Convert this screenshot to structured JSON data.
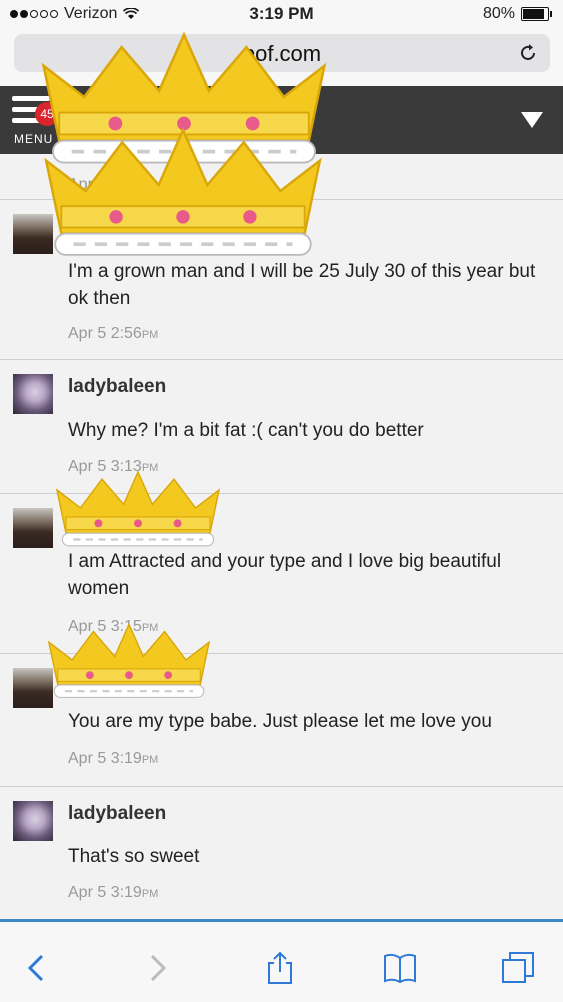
{
  "status": {
    "carrier": "Verizon",
    "time": "3:19 PM",
    "battery": "80%",
    "signal_bars_filled": 2,
    "battery_level": 0.8
  },
  "browser": {
    "url": "pof.com"
  },
  "header": {
    "menu_label": "MENU",
    "notification_count": "45"
  },
  "messages": [
    {
      "sender_type": "man",
      "sender": "",
      "text": "",
      "time": "Apr 5 2:54",
      "ampm": "PM"
    },
    {
      "sender_type": "man",
      "sender": "",
      "text": "I'm a grown man and I will be 25 July 30 of this year but ok then",
      "time": "Apr 5 2:56",
      "ampm": "PM"
    },
    {
      "sender_type": "lady",
      "sender": "ladybaleen",
      "text": "Why me? I'm a bit fat :( can't you do better",
      "time": "Apr 5 3:13",
      "ampm": "PM"
    },
    {
      "sender_type": "man",
      "sender": "",
      "text": "I am Attracted and your type and I love big beautiful women",
      "time": "Apr 5 3:15",
      "ampm": "PM"
    },
    {
      "sender_type": "man",
      "sender": "",
      "text": "You are my type babe. Just please let me love you",
      "time": "Apr 5 3:19",
      "ampm": "PM"
    },
    {
      "sender_type": "lady",
      "sender": "ladybaleen",
      "text": "That's so sweet",
      "time": "Apr 5 3:19",
      "ampm": "PM"
    }
  ],
  "toolbar": {
    "back": "back-icon",
    "forward": "forward-icon",
    "share": "share-icon",
    "bookmarks": "bookmarks-icon",
    "tabs": "tabs-icon"
  },
  "colors": {
    "header_bg": "#3a3a3a",
    "badge": "#d7262d",
    "ios_blue": "#2f7ad6",
    "crown_gold": "#f3c81f"
  }
}
